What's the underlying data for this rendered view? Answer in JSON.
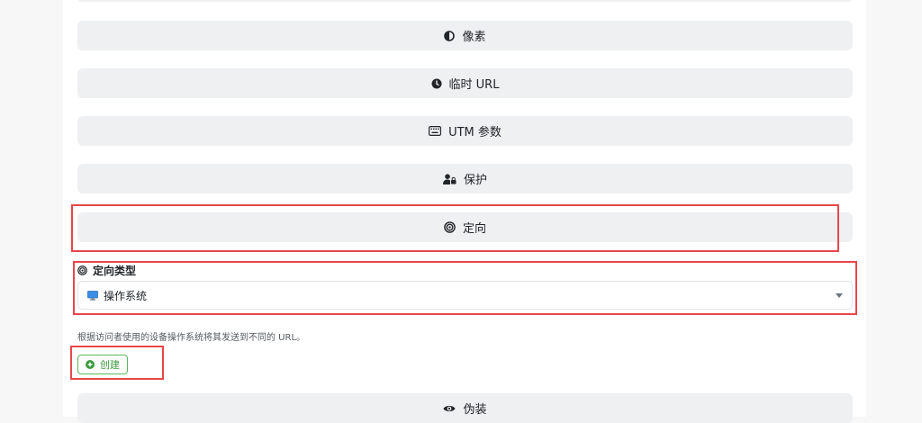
{
  "sections": {
    "pixels": {
      "label": "像素",
      "icon": "half-circle-icon"
    },
    "temp_url": {
      "label": "临时 URL",
      "icon": "clock-icon"
    },
    "utm": {
      "label": "UTM 参数",
      "icon": "keyboard-icon"
    },
    "protection": {
      "label": "保护",
      "icon": "user-lock-icon"
    },
    "targeting": {
      "label": "定向",
      "icon": "bullseye-icon"
    },
    "cloaking": {
      "label": "伪装",
      "icon": "eye-icon"
    }
  },
  "targeting_form": {
    "type_label": "定向类型",
    "type_value": "操作系统",
    "help_text": "根据访问者使用的设备操作系统将其发送到不同的 URL。",
    "create_label": "创建"
  },
  "colors": {
    "highlight": "#e8474a",
    "create_green": "#5cb85c",
    "section_bg": "#eff0f2"
  }
}
